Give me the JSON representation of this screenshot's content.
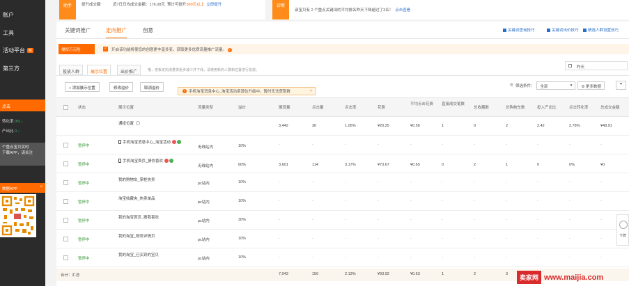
{
  "sidebar": {
    "nav": [
      {
        "label": "账户"
      },
      {
        "label": "工具"
      },
      {
        "label": "活动平台",
        "badge": "新"
      },
      {
        "label": "第三方"
      }
    ],
    "panel_title": "点击",
    "stats": [
      {
        "label": "转化率",
        "value": "0%",
        "trend": "↓"
      },
      {
        "label": "产出比",
        "value": "0",
        "trend": "↓"
      }
    ],
    "note_lines": [
      "个重点宝贝实时",
      "下载APP，请关注"
    ],
    "app_title": "数据APP",
    "app_close": "×"
  },
  "top_cards": {
    "left_tag": "助手",
    "left_text1": "提升成交额",
    "left_text2": "近7日日均成交金额：176.08元",
    "left_text3": "预计可提升",
    "left_highlight": "300元以上",
    "left_link": "立即提升",
    "right_tag": "诊断",
    "right_text": "该宝贝有 2 个重点关键词的平均排名昨天下降超过了3名！",
    "right_link": "点击查看"
  },
  "tabs": [
    {
      "label": "关键词推广",
      "active": false
    },
    {
      "label": "定向推广",
      "active": true
    },
    {
      "label": "创意",
      "active": false
    }
  ],
  "tip_links": [
    "关键词查询技巧",
    "关键词出价技巧",
    "精选人群设置技巧"
  ],
  "orange_bar": {
    "tag": "侵权万元险",
    "text": "开启该功能将使您的创意更丰富多变，获取更多优质流量推广流量。",
    "check_mark": "✓"
  },
  "subtabs": [
    {
      "label": "投放人群",
      "active": false
    },
    {
      "label": "展示位置",
      "active": true
    },
    {
      "label": "出价推广",
      "active": false
    }
  ],
  "subtab_note": "哦，老板定向流量将逐步减少并下线，请使用新的人群和位置进行投放。",
  "date": "昨天",
  "toolbar": {
    "add_btn": "添加展示位置",
    "edit_btn": "修改溢价",
    "cancel_btn": "取消溢价",
    "tooltip": "手机淘宝消息中心_淘宝活动资源位升级中，暂时无法获取数",
    "tooltip_close": "×",
    "filter_label": "筛选条件：",
    "filter_value": "全部",
    "more_label": "更多数据",
    "caret": "▾"
  },
  "table": {
    "headers": [
      "状态",
      "展示位置",
      "流量类型",
      "溢价",
      "展现量",
      "点击量",
      "点击率",
      "花费",
      "平均点击花费",
      "直接成交笔数",
      "总收藏数",
      "总购物车数",
      "投入产出比",
      "点击转化率",
      "总成交金额"
    ],
    "rows": [
      {
        "status": "",
        "name": "通投位置",
        "type": "",
        "premium": "",
        "impressions": "3,442",
        "clicks": "36",
        "ctr": "1.05%",
        "cost": "¥20.25",
        "cpc": "¥0.56",
        "direct": "1",
        "fav": "0",
        "cart": "2",
        "roi": "2.42",
        "cvr": "2.78%",
        "gmv": "¥48.91"
      },
      {
        "status": "暂停中",
        "name": "手机淘宝消息中心_淘宝活动",
        "type": "无线站内",
        "premium": "10%",
        "impressions": "-",
        "clicks": "-",
        "ctr": "-",
        "cost": "-",
        "cpc": "-",
        "direct": "-",
        "fav": "-",
        "cart": "-",
        "roi": "-",
        "cvr": "-",
        "gmv": "-"
      },
      {
        "status": "暂停中",
        "name": "手机淘宝首页_猜你喜欢",
        "type": "无线站内",
        "premium": "60%",
        "impressions": "3,601",
        "clicks": "114",
        "ctr": "3.17%",
        "cost": "¥73.67",
        "cpc": "¥0.65",
        "direct": "0",
        "fav": "2",
        "cart": "1",
        "roi": "0",
        "cvr": "0%",
        "gmv": "¥0"
      },
      {
        "status": "暂停中",
        "name": "我的购物车_掌柜热卖",
        "type": "pc站内",
        "premium": "10%",
        "impressions": "-",
        "clicks": "-",
        "ctr": "-",
        "cost": "-",
        "cpc": "-",
        "direct": "-",
        "fav": "-",
        "cart": "-",
        "roi": "-",
        "cvr": "-",
        "gmv": "-"
      },
      {
        "status": "暂停中",
        "name": "淘宝收藏夹_热卖单品",
        "type": "pc站内",
        "premium": "10%",
        "impressions": "-",
        "clicks": "-",
        "ctr": "-",
        "cost": "-",
        "cpc": "-",
        "direct": "-",
        "fav": "-",
        "cart": "-",
        "roi": "-",
        "cvr": "-",
        "gmv": "-"
      },
      {
        "status": "暂停中",
        "name": "我的淘宝首页_猜我喜欢",
        "type": "pc站内",
        "premium": "30%",
        "impressions": "-",
        "clicks": "-",
        "ctr": "-",
        "cost": "-",
        "cpc": "-",
        "direct": "-",
        "fav": "-",
        "cart": "-",
        "roi": "-",
        "cvr": "-",
        "gmv": "-"
      },
      {
        "status": "暂停中",
        "name": "我的淘宝_物流详情页",
        "type": "pc站内",
        "premium": "10%",
        "impressions": "-",
        "clicks": "-",
        "ctr": "-",
        "cost": "-",
        "cpc": "-",
        "direct": "-",
        "fav": "-",
        "cart": "-",
        "roi": "-",
        "cvr": "-",
        "gmv": "-"
      },
      {
        "status": "暂停中",
        "name": "我的淘宝_已买到的宝贝",
        "type": "pc站内",
        "premium": "10%",
        "impressions": "-",
        "clicks": "-",
        "ctr": "-",
        "cost": "-",
        "cpc": "-",
        "direct": "-",
        "fav": "-",
        "cart": "-",
        "roi": "-",
        "cvr": "-",
        "gmv": "-"
      }
    ],
    "total": {
      "label": "合计：汇总",
      "impressions": "7,043",
      "clicks": "150",
      "ctr": "2.13%",
      "cost": "¥93.92",
      "cpc": "¥0.63",
      "direct": "1",
      "fav": "2",
      "cart": "3"
    }
  },
  "watermark": {
    "logo": "卖家网",
    "url": "www.maijia.com"
  },
  "side_float": {
    "label": "卡牌"
  }
}
